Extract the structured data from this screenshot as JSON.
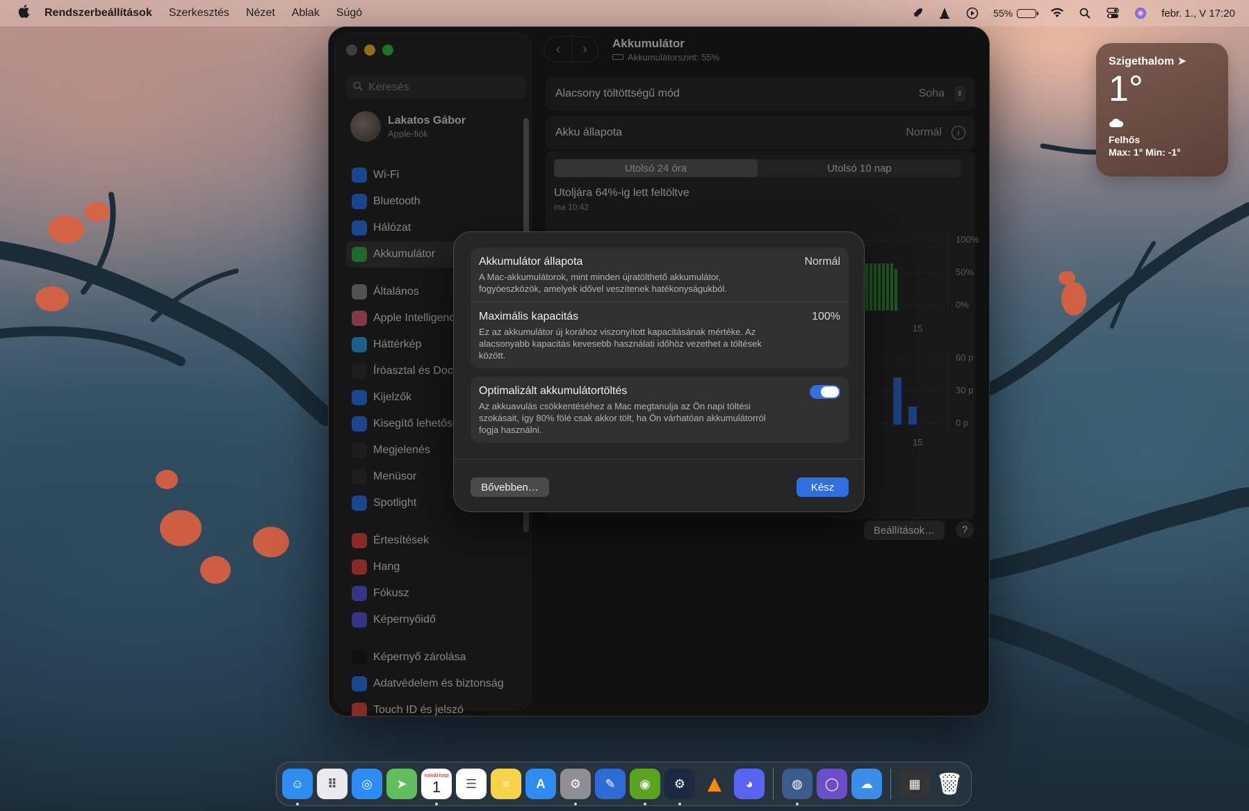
{
  "menubar": {
    "app_name": "Rendszerbeállítások",
    "menus": [
      "Szerkesztés",
      "Nézet",
      "Ablak",
      "Súgó"
    ],
    "battery_percent": "55%",
    "datetime": "febr. 1., V  17:20"
  },
  "weather": {
    "city": "Szigethalom",
    "temp": "1°",
    "condition": "Felhős",
    "range": "Max: 1° Min: -1°"
  },
  "sidebar": {
    "search_placeholder": "Keresés",
    "profile_name": "Lakatos Gábor",
    "profile_sub": "Apple-fiók",
    "items": [
      {
        "label": "Wi-Fi",
        "color": "#2a7bf6",
        "icon": "wifi-icon"
      },
      {
        "label": "Bluetooth",
        "color": "#2a7bf6",
        "icon": "bluetooth-icon"
      },
      {
        "label": "Hálózat",
        "color": "#2a7bf6",
        "icon": "globe-icon"
      },
      {
        "label": "Akkumulátor",
        "color": "#33b34a",
        "icon": "battery-icon"
      },
      {
        "label": "Általános",
        "color": "#8e8e93",
        "icon": "gear-icon"
      },
      {
        "label": "Apple Intelligence",
        "color": "#e0627a",
        "icon": "sparkle-icon"
      },
      {
        "label": "Háttérkép",
        "color": "#2fa8e8",
        "icon": "flower-icon"
      },
      {
        "label": "Íróasztal és Dock",
        "color": "#333333",
        "icon": "dock-icon"
      },
      {
        "label": "Kijelzők",
        "color": "#2a7bf6",
        "icon": "sun-icon"
      },
      {
        "label": "Kisegítő lehetőségek",
        "color": "#2a7bf6",
        "icon": "accessibility-icon"
      },
      {
        "label": "Megjelenés",
        "color": "#333333",
        "icon": "appearance-icon"
      },
      {
        "label": "Menüsor",
        "color": "#333333",
        "icon": "menubar-icon"
      },
      {
        "label": "Spotlight",
        "color": "#2a7bf6",
        "icon": "search-icon"
      },
      {
        "label": "Értesítések",
        "color": "#e84a43",
        "icon": "bell-icon"
      },
      {
        "label": "Hang",
        "color": "#e84a43",
        "icon": "speaker-icon"
      },
      {
        "label": "Fókusz",
        "color": "#5e5ce6",
        "icon": "moon-icon"
      },
      {
        "label": "Képernyőidő",
        "color": "#5e5ce6",
        "icon": "hourglass-icon"
      },
      {
        "label": "Képernyő zárolása",
        "color": "#1c1c1e",
        "icon": "lock-icon"
      },
      {
        "label": "Adatvédelem és biztonság",
        "color": "#2a7bf6",
        "icon": "hand-icon"
      },
      {
        "label": "Touch ID és jelszó",
        "color": "#e84a43",
        "icon": "fingerprint-icon"
      }
    ]
  },
  "toolbar": {
    "title": "Akkumulátor",
    "subtitle": "Akkumulátorszint: 55%"
  },
  "settings": {
    "low_power_label": "Alacsony töltöttségű mód",
    "low_power_value": "Soha",
    "health_label": "Akku állapota",
    "health_value": "Normál",
    "tab_24h": "Utolsó 24 óra",
    "tab_10d": "Utolsó 10 nap",
    "last_charged": "Utoljára 64%-ig lett feltöltve",
    "last_charged_time": "ma 10:42",
    "axis_top": [
      "100%",
      "50%",
      "0%"
    ],
    "axis_bottom": [
      "60 p",
      "30 p",
      "0 p"
    ],
    "x_tick": "15",
    "settings_button": "Beállítások…",
    "help_button": "?"
  },
  "modal": {
    "health_title": "Akkumulátor állapota",
    "health_value": "Normál",
    "health_desc": "A Mac-akkumulátorok, mint minden újratölthető akkumulátor, fogyóeszközök, amelyek idővel veszítenek hatékonyságukból.",
    "capacity_title": "Maximális kapacitás",
    "capacity_value": "100%",
    "capacity_desc": "Ez az akkumulátor új korához viszonyított kapacitásának mértéke. Az alacsonyabb kapacitás kevesebb használati időhöz vezethet a töltések között.",
    "optimized_title": "Optimalizált akkumulátortöltés",
    "optimized_desc": "Az akkuavulás csökkentéséhez a Mac megtanulja az Ön napi töltési szokásait, így 80% fölé csak akkor tölt, ha Ön várhatóan akkumulátorról fogja használni.",
    "optimized_on": true,
    "more_button": "Bővebben…",
    "done_button": "Kész"
  },
  "dock": {
    "calendar_month": "vasárnap",
    "calendar_day": "1",
    "apps": [
      {
        "name": "finder-app-icon",
        "color": "#2d8cf0",
        "glyph": "☺"
      },
      {
        "name": "launchpad-app-icon",
        "color": "#e9e9ee",
        "glyph": "⠿"
      },
      {
        "name": "safari-app-icon",
        "color": "#2c8df6",
        "glyph": "◎"
      },
      {
        "name": "maps-app-icon",
        "color": "#5fbf5a",
        "glyph": "➤"
      },
      {
        "name": "calendar-app-icon",
        "color": "#ffffff",
        "glyph": ""
      },
      {
        "name": "reminders-app-icon",
        "color": "#ffffff",
        "glyph": "☰"
      },
      {
        "name": "notes-app-icon",
        "color": "#f6d34a",
        "glyph": "≡"
      },
      {
        "name": "appstore-app-icon",
        "color": "#2d8cf0",
        "glyph": "A"
      },
      {
        "name": "system-settings-app-icon",
        "color": "#8e8e93",
        "glyph": "⚙"
      },
      {
        "name": "xcode-app-icon",
        "color": "#2d6bd6",
        "glyph": "✎"
      },
      {
        "name": "nvidia-app-icon",
        "color": "#5aa321",
        "glyph": "◉"
      },
      {
        "name": "steam-app-icon",
        "color": "#1b2a42",
        "glyph": "⚙"
      },
      {
        "name": "vlc-app-icon",
        "color": "transparent",
        "glyph": "▲"
      },
      {
        "name": "discord-app-icon",
        "color": "#5865f2",
        "glyph": "◕"
      },
      {
        "name": "sep",
        "color": "",
        "glyph": ""
      },
      {
        "name": "automator-app-icon",
        "color": "#3a5c8c",
        "glyph": "◍"
      },
      {
        "name": "iina-app-icon",
        "color": "#6c4ec9",
        "glyph": "◯"
      },
      {
        "name": "weather-app-icon",
        "color": "#3a8ee8",
        "glyph": "☁"
      },
      {
        "name": "sep",
        "color": "",
        "glyph": ""
      },
      {
        "name": "downloads-stack-icon",
        "color": "#333333",
        "glyph": "▦"
      },
      {
        "name": "trash-icon",
        "color": "transparent",
        "glyph": "🗑"
      }
    ]
  }
}
